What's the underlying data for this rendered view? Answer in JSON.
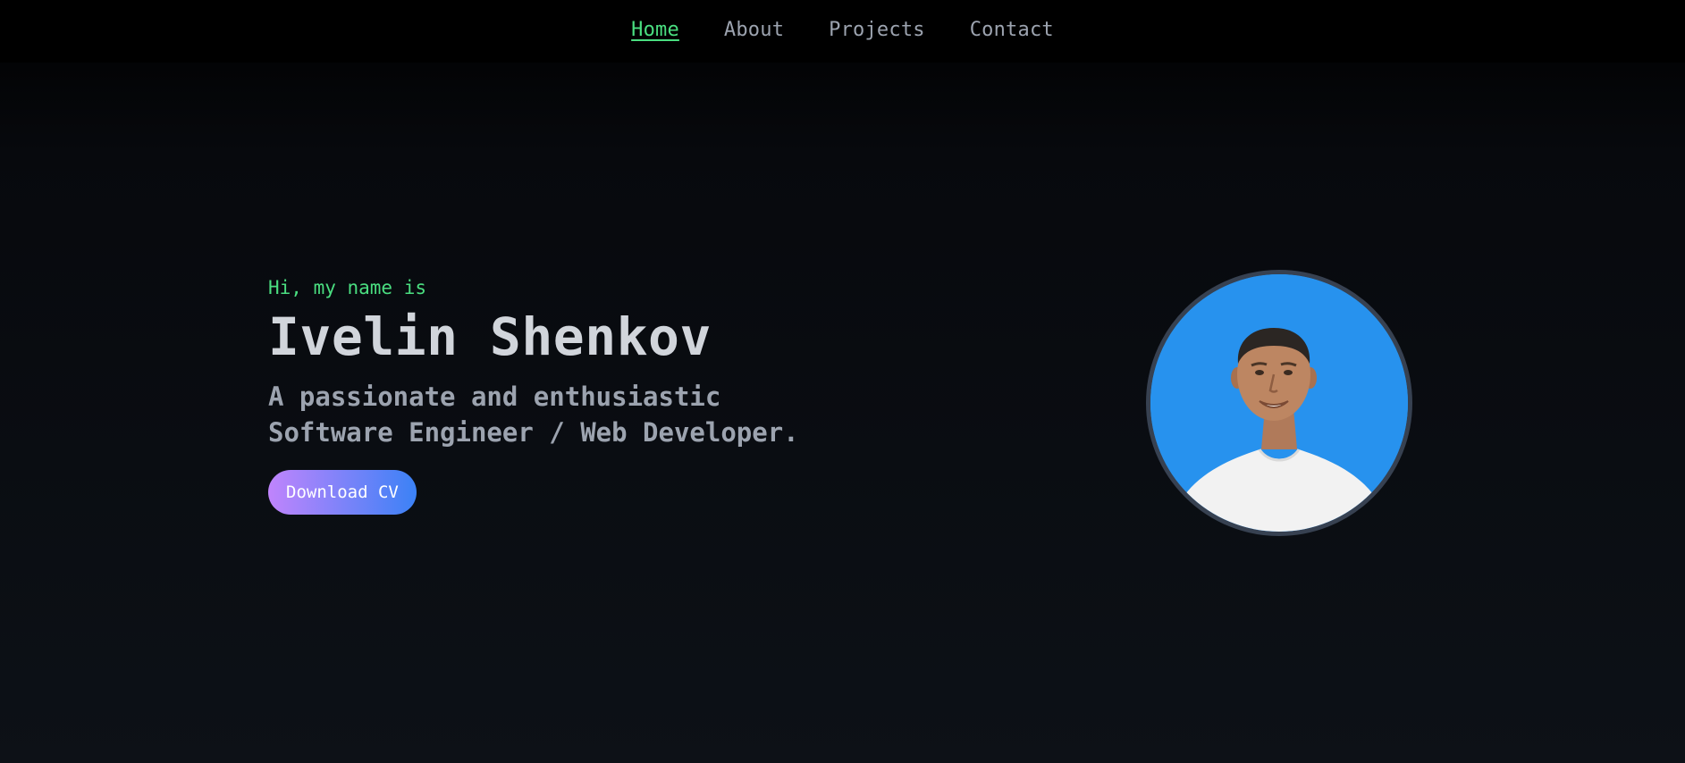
{
  "nav": {
    "items": [
      {
        "label": "Home",
        "active": true
      },
      {
        "label": "About",
        "active": false
      },
      {
        "label": "Projects",
        "active": false
      },
      {
        "label": "Contact",
        "active": false
      }
    ]
  },
  "hero": {
    "greeting": "Hi, my name is",
    "name": "Ivelin Shenkov",
    "tagline_line1": "A passionate and enthusiastic",
    "tagline_line2": "Software Engineer / Web Developer.",
    "cta_label": "Download CV"
  },
  "colors": {
    "accent_green": "#4ade80",
    "gradient_start": "#c084fc",
    "gradient_end": "#3b82f6",
    "avatar_bg": "#2792ee"
  }
}
